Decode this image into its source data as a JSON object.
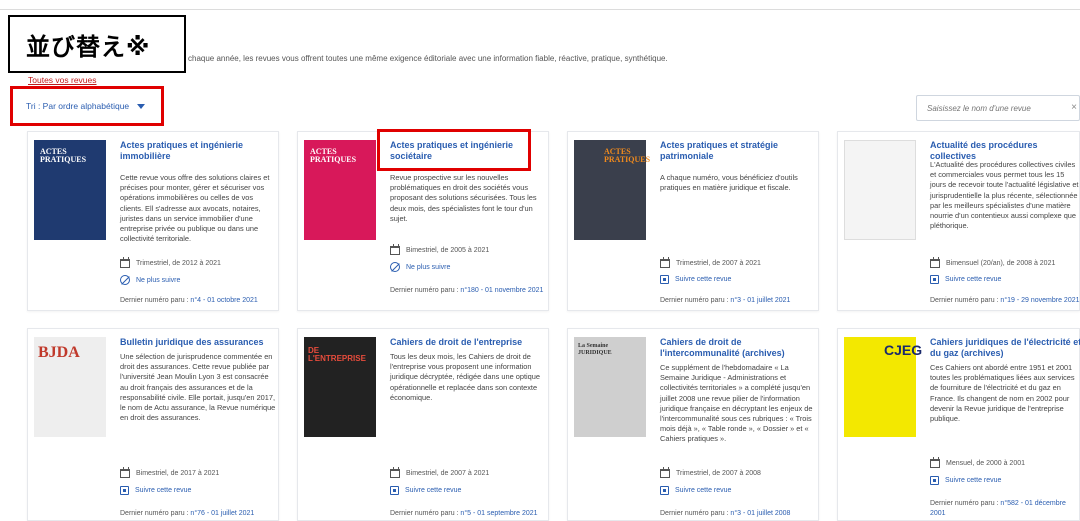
{
  "callout": "並び替え※",
  "intro_text": "chaque année, les revues vous offrent toutes une même exigence éditoriale avec une information fiable, réactive, pratique, synthétique.",
  "all_link": "Toutes vos revues",
  "sort": {
    "label": "Tri : Par ordre alphabétique"
  },
  "search": {
    "placeholder": "Saisissez le nom d'une revue",
    "clear": "×"
  },
  "cards": [
    {
      "title": "Actes pratiques et ingénierie immobilière",
      "description": "Cette revue vous offre des solutions claires et précises pour monter, gérer et sécuriser vos opérations immobilières ou celles de vos clients. Ell s'adresse aux avocats, notaires, juristes dans un service immobilier d'une entreprise privée ou publique ou dans une collectivité territoriale.",
      "frequency": "Trimestriel, de 2012 à 2021",
      "follow": "Ne plus suivre",
      "last_label": "Dernier numéro paru : ",
      "last_value": "n°4 - 01 octobre 2021",
      "cover_text": "ACTES PRATIQUES"
    },
    {
      "title": "Actes pratiques et ingénierie sociétaire",
      "description": "Revue prospective sur les nouvelles problématiques en droit des sociétés vous proposant des solutions sécurisées. Tous les deux mois, des spécialistes font le tour d'un sujet.",
      "frequency": "Bimestriel, de 2005 à 2021",
      "follow": "Ne plus suivre",
      "last_label": "Dernier numéro paru : ",
      "last_value": "n°180 - 01 novembre 2021",
      "cover_text": "ACTES PRATIQUES"
    },
    {
      "title": "Actes pratiques et stratégie patrimoniale",
      "description": "A chaque numéro, vous bénéficiez d'outils pratiques en matière juridique et fiscale.",
      "frequency": "Trimestriel, de 2007 à 2021",
      "follow": "Suivre cette revue",
      "last_label": "Dernier numéro paru : ",
      "last_value": "n°3 - 01 juillet 2021",
      "cover_text": "ACTES PRATIQUES"
    },
    {
      "title": "Actualité des procédures collectives",
      "description": "L'Actualité des procédures collectives civiles et commerciales vous permet tous les 15 jours de recevoir toute l'actualité législative et jurisprudentielle la plus récente, sélectionnée par les meilleurs spécialistes d'une matière nourrie d'un contentieux aussi complexe que pléthorique.",
      "frequency": "Bimensuel (20/an), de 2008 à 2021",
      "follow": "Suivre cette revue",
      "last_label": "Dernier numéro paru : ",
      "last_value": "n°19 - 29 novembre 2021",
      "cover_text": ""
    },
    {
      "title": "Bulletin juridique des assurances",
      "description": "Une sélection de jurisprudence commentée en droit des assurances. Cette revue publiée par l'université Jean Moulin Lyon 3 est consacrée au droit français des assurances et de la responsabilité civile. Elle portait, jusqu'en 2017, le nom de Actu assurance, la Revue numérique en droit des assurances.",
      "frequency": "Bimestriel, de 2017 à 2021",
      "follow": "Suivre cette revue",
      "last_label": "Dernier numéro paru : ",
      "last_value": "n°76 - 01 juillet 2021",
      "cover_text": "BJDA"
    },
    {
      "title": "Cahiers de droit de l'entreprise",
      "description": "Tous les deux mois, les Cahiers de droit de l'entreprise vous proposent une information juridique décryptée, rédigée dans une optique opérationnelle et replacée dans son contexte économique.",
      "frequency": "Bimestriel, de 2007 à 2021",
      "follow": "Suivre cette revue",
      "last_label": "Dernier numéro paru : ",
      "last_value": "n°5 - 01 septembre 2021",
      "cover_text": "DE L'ENTREPRISE"
    },
    {
      "title": "Cahiers de droit de l'intercommunalité (archives)",
      "description": "Ce supplément de l'hebdomadaire « La Semaine Juridique - Administrations et collectivités territoriales » a complété jusqu'en juillet 2008 une revue pilier de l'information juridique française en décryptant les enjeux de l'intercommunalité sous ces rubriques : « Trois mois déjà », « Table ronde », « Dossier » et « Cahiers pratiques ».",
      "frequency": "Trimestriel, de 2007 à 2008",
      "follow": "Suivre cette revue",
      "last_label": "Dernier numéro paru : ",
      "last_value": "n°3 - 01 juillet 2008",
      "cover_text": "La Semaine JURIDIQUE"
    },
    {
      "title": "Cahiers juridiques de l'électricité et du gaz (archives)",
      "description": "Ces Cahiers ont abordé entre 1951 et 2001 toutes les problématiques liées aux services de fourniture de l'électricité et du gaz en France. Ils changent de nom en 2002 pour devenir la Revue juridique de l'entreprise publique.",
      "frequency": "Mensuel, de 2000 à 2001",
      "follow": "Suivre cette revue",
      "last_label": "Dernier numéro paru : ",
      "last_value": "n°582 - 01 décembre 2001",
      "cover_text": "CJEG"
    }
  ]
}
